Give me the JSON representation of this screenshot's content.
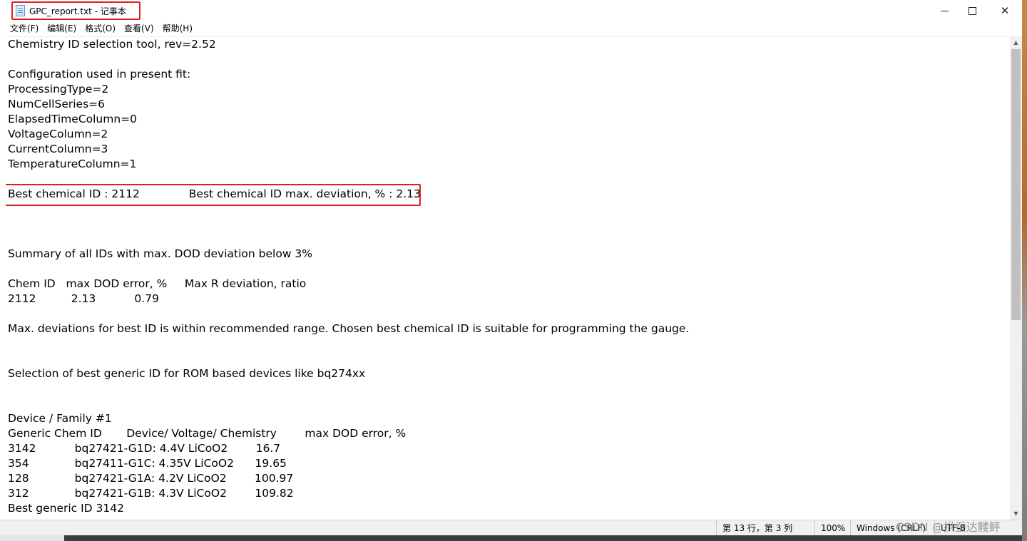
{
  "window": {
    "title": "GPC_report.txt - 记事本"
  },
  "window_controls": {
    "minimize": "minimize",
    "maximize": "maximize",
    "close": "✕"
  },
  "menu": [
    {
      "label": "文件(F)"
    },
    {
      "label": "编辑(E)"
    },
    {
      "label": "格式(O)"
    },
    {
      "label": "查看(V)"
    },
    {
      "label": "帮助(H)"
    }
  ],
  "document": {
    "lines": [
      "Chemistry ID selection tool, rev=2.52",
      "",
      "Configuration used in present fit:",
      "ProcessingType=2",
      "NumCellSeries=6",
      "ElapsedTimeColumn=0",
      "VoltageColumn=2",
      "CurrentColumn=3",
      "TemperatureColumn=1",
      "",
      "Best chemical ID : 2112              Best chemical ID max. deviation, % : 2.13",
      "",
      "",
      "",
      "Summary of all IDs with max. DOD deviation below 3%",
      "",
      "Chem ID   max DOD error, %     Max R deviation, ratio",
      "2112          2.13           0.79",
      "",
      "Max. deviations for best ID is within recommended range. Chosen best chemical ID is suitable for programming the gauge.",
      "",
      "",
      "Selection of best generic ID for ROM based devices like bq274xx",
      "",
      "",
      "Device / Family #1",
      "Generic Chem ID       Device/ Voltage/ Chemistry        max DOD error, %",
      "3142           bq27421-G1D: 4.4V LiCoO2        16.7",
      "354             bq27411-G1C: 4.35V LiCoO2      19.65",
      "128             bq27421-G1A: 4.2V LiCoO2        100.97",
      "312             bq27421-G1B: 4.3V LiCoO2        109.82",
      "Best generic ID 3142"
    ]
  },
  "scrollbar": {
    "up_arrow": "▲",
    "down_arrow": "▼"
  },
  "status": {
    "position": "第 13 行，第 3 列",
    "zoom": "100%",
    "line_ending": "Windows (CRLF)",
    "encoding": "UTF-8"
  },
  "watermark": "CSDN @拱蚕达髅鲆"
}
